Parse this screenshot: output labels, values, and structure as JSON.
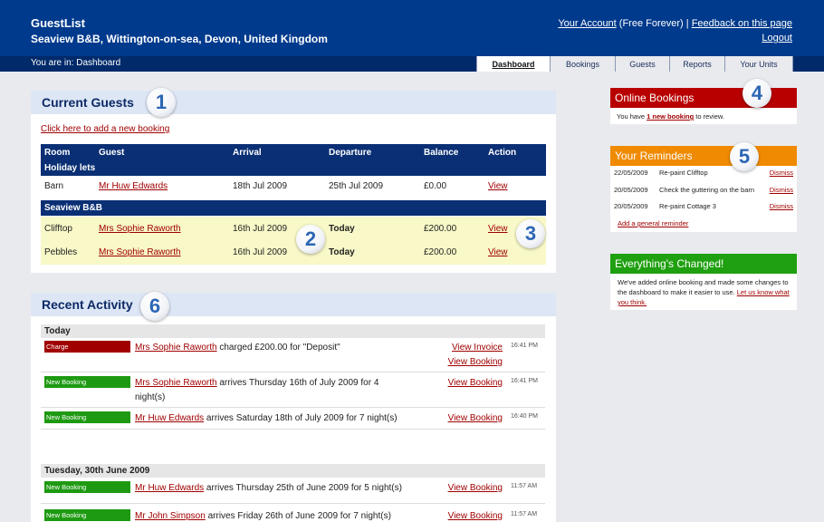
{
  "header": {
    "app_name": "GuestList",
    "venue": "Seaview B&B, Wittington-on-sea, Devon, United Kingdom",
    "account_link": "Your Account",
    "account_plan": "(Free Forever)",
    "separator": "|",
    "feedback_link": "Feedback on this page",
    "logout": "Logout",
    "you_are_in": "You are in: Dashboard",
    "tabs": [
      "Dashboard",
      "Bookings",
      "Guests",
      "Reports",
      "Your Units"
    ],
    "active_tab": "Dashboard"
  },
  "badges": [
    "1",
    "2",
    "3",
    "4",
    "5",
    "6"
  ],
  "current_guests": {
    "title": "Current Guests",
    "add_link": "Click here to add a new booking",
    "columns": [
      "Room",
      "Guest",
      "Arrival",
      "Departure",
      "Balance",
      "Action"
    ],
    "groups": [
      {
        "name": "Holiday lets",
        "rows": [
          {
            "room": "Barn",
            "guest": "Mr Huw Edwards",
            "arrival": "18th Jul 2009",
            "departure": "25th Jul 2009",
            "balance": "£0.00",
            "action": "View"
          }
        ]
      },
      {
        "name": "Seaview B&B",
        "rows": [
          {
            "room": "Clifftop",
            "guest": "Mrs Sophie Raworth",
            "arrival": "16th Jul 2009",
            "departure": "Today",
            "balance": "£200.00",
            "action": "View"
          },
          {
            "room": "Pebbles",
            "guest": "Mrs Sophie Raworth",
            "arrival": "16th Jul 2009",
            "departure": "Today",
            "balance": "£200.00",
            "action": "View"
          }
        ]
      }
    ]
  },
  "online_bookings": {
    "title": "Online Bookings",
    "text_before": "You have",
    "link": "1 new booking",
    "text_after": "to review.",
    "color": "#b80000"
  },
  "reminders": {
    "title": "Your Reminders",
    "color": "#f08a00",
    "items": [
      {
        "date": "22/05/2009",
        "text": "Re-paint Clifftop",
        "action": "Dismiss"
      },
      {
        "date": "20/05/2009",
        "text": "Check the guttering on the barn",
        "action": "Dismiss"
      },
      {
        "date": "20/05/2009",
        "text": "Re-paint Cottage 3",
        "action": "Dismiss"
      }
    ],
    "add_link": "Add a general reminder"
  },
  "changed": {
    "title": "Everything's Changed!",
    "color": "#1fa010",
    "text": "We've added online booking and made some changes to the dashboard to make it easier to use.",
    "link": "Let us know what you think."
  },
  "activity": {
    "title": "Recent Activity",
    "days": [
      {
        "label": "Today",
        "items": [
          {
            "tag": "Charge",
            "tag_color": "#a00000",
            "guest": "Mrs Sophie Raworth",
            "text": "charged £200.00 for \"Deposit\"",
            "links": [
              "View Invoice",
              "View Booking"
            ],
            "time": "16:41 PM"
          },
          {
            "tag": "New Booking",
            "tag_color": "#1e9a12",
            "guest": "Mrs Sophie Raworth",
            "text": "arrives Thursday 16th of July 2009 for 4 night(s)",
            "links": [
              "View Booking"
            ],
            "time": "16:41 PM"
          },
          {
            "tag": "New Booking",
            "tag_color": "#1e9a12",
            "guest": "Mr Huw Edwards",
            "text": "arrives Saturday 18th of July 2009 for 7 night(s)",
            "links": [
              "View Booking"
            ],
            "time": "16:40 PM"
          }
        ]
      },
      {
        "label": "Tuesday, 30th June 2009",
        "items": [
          {
            "tag": "New Booking",
            "tag_color": "#1e9a12",
            "guest": "Mr Huw Edwards",
            "text": "arrives Thursday 25th of June 2009 for 5 night(s)",
            "links": [
              "View Booking"
            ],
            "time": "11:57 AM"
          },
          {
            "tag": "New Booking",
            "tag_color": "#1e9a12",
            "guest": "Mr John Simpson",
            "text": "arrives Friday 26th of June 2009 for 7 night(s)",
            "links": [
              "View Booking"
            ],
            "time": "11:57 AM"
          }
        ]
      }
    ]
  }
}
